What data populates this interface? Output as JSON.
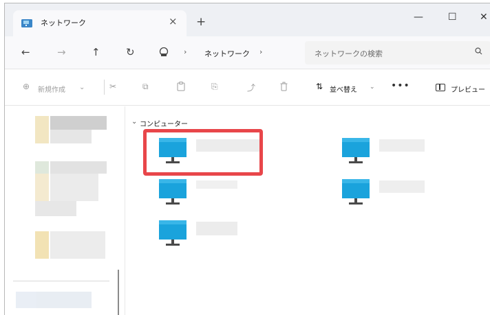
{
  "window": {
    "tab_title": "ネットワーク",
    "tab_close": "×",
    "new_tab": "+",
    "minimize": "—",
    "maximize": "☐",
    "close": "✕"
  },
  "address": {
    "back": "←",
    "forward": "→",
    "up": "↑",
    "refresh": "↻",
    "separator": "›",
    "breadcrumb": "ネットワーク",
    "search_placeholder": "ネットワークの検索",
    "search_icon": "magnifier-icon"
  },
  "commands": {
    "new_label": "新規作成",
    "new_icon": "⊕",
    "new_caret": "⌄",
    "cut": "✂",
    "copy": "⧉",
    "paste": "📋",
    "rename": "⎘",
    "share": "⤴",
    "delete": "🗑",
    "sort_icon": "⇅",
    "sort_label": "並べ替え",
    "sort_caret": "⌄",
    "more": "•••",
    "preview_label": "プレビュー"
  },
  "content": {
    "group_chevron": "⌄",
    "group_label": "コンピューター",
    "items": [
      {
        "name": ""
      },
      {
        "name": ""
      },
      {
        "name": ""
      },
      {
        "name": ""
      },
      {
        "name": ""
      }
    ]
  },
  "colors": {
    "highlight": "#e8464a",
    "monitor_screen": "#1aa3dc",
    "monitor_stand": "#4a4a4a"
  }
}
